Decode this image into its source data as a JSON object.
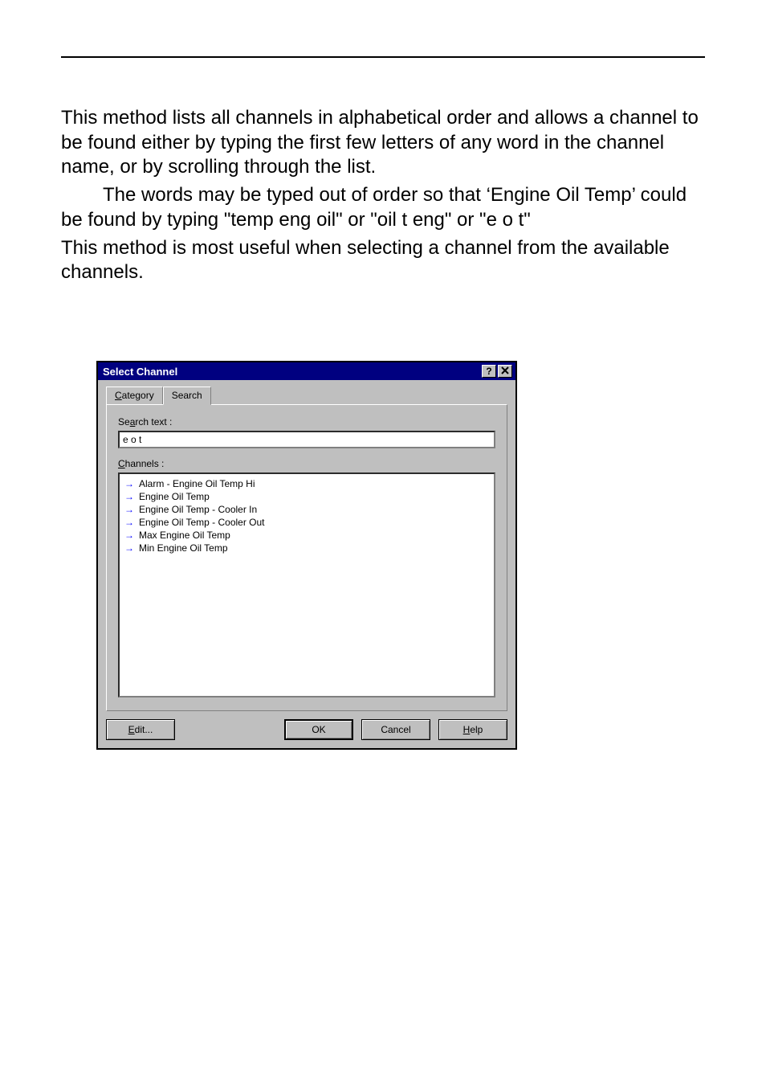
{
  "body": {
    "p1": "This method lists all channels in alphabetical order and allows a channel to be found either by typing the first few letters of any word in the channel name, or by scrolling through the list.",
    "p2": "The words may be typed out of order so that ‘Engine Oil Temp’ could be found by typing \"temp eng oil\" or \"oil t eng\" or \"e o t\"",
    "p3": "This method is most useful when selecting a channel from the available channels."
  },
  "dialog": {
    "title": "Select Channel",
    "help_glyph": "?",
    "tabs": {
      "category": "Category",
      "search": "Search"
    },
    "search_label_pre": "Se",
    "search_label_ul": "a",
    "search_label_post": "rch text :",
    "search_value": "e o t",
    "channels_label_ul": "C",
    "channels_label_post": "hannels :",
    "items": [
      "Alarm - Engine Oil Temp Hi",
      "Engine Oil Temp",
      "Engine Oil Temp - Cooler In",
      "Engine Oil Temp - Cooler Out",
      "Max Engine Oil Temp",
      "Min Engine Oil Temp"
    ],
    "buttons": {
      "edit_ul": "E",
      "edit_post": "dit...",
      "ok": "OK",
      "cancel": "Cancel",
      "help_ul": "H",
      "help_post": "elp"
    }
  }
}
